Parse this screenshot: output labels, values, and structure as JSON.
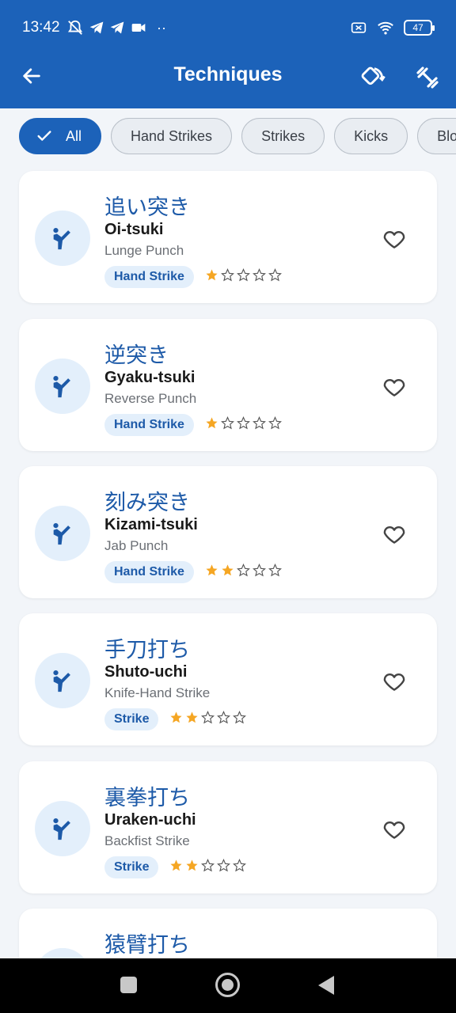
{
  "status_bar": {
    "time": "13:42",
    "battery": "47"
  },
  "app_bar": {
    "title": "Techniques"
  },
  "filters": [
    {
      "label": "All",
      "selected": true
    },
    {
      "label": "Hand Strikes",
      "selected": false
    },
    {
      "label": "Strikes",
      "selected": false
    },
    {
      "label": "Kicks",
      "selected": false
    },
    {
      "label": "Blo",
      "selected": false
    }
  ],
  "techniques": [
    {
      "japanese": "追い突き",
      "romaji": "Oi-tsuki",
      "english": "Lunge Punch",
      "category": "Hand Strike",
      "difficulty": 1,
      "max_difficulty": 5,
      "favorite": false
    },
    {
      "japanese": "逆突き",
      "romaji": "Gyaku-tsuki",
      "english": "Reverse Punch",
      "category": "Hand Strike",
      "difficulty": 1,
      "max_difficulty": 5,
      "favorite": false
    },
    {
      "japanese": "刻み突き",
      "romaji": "Kizami-tsuki",
      "english": "Jab Punch",
      "category": "Hand Strike",
      "difficulty": 2,
      "max_difficulty": 5,
      "favorite": false
    },
    {
      "japanese": "手刀打ち",
      "romaji": "Shuto-uchi",
      "english": "Knife-Hand Strike",
      "category": "Strike",
      "difficulty": 2,
      "max_difficulty": 5,
      "favorite": false
    },
    {
      "japanese": "裏拳打ち",
      "romaji": "Uraken-uchi",
      "english": "Backfist Strike",
      "category": "Strike",
      "difficulty": 2,
      "max_difficulty": 5,
      "favorite": false
    },
    {
      "japanese": "猿臂打ち",
      "romaji": "",
      "english": "",
      "category": "",
      "difficulty": 0,
      "max_difficulty": 5,
      "favorite": false
    }
  ],
  "colors": {
    "primary": "#1c62b9",
    "star_filled": "#f5a623",
    "tag_bg": "#e3effb"
  },
  "icons": {
    "back": "arrow-left-icon",
    "action_1": "rotate-icon",
    "action_2": "dumbbell-icon",
    "technique": "karate-kick-icon",
    "favorite": "heart-outline-icon"
  }
}
